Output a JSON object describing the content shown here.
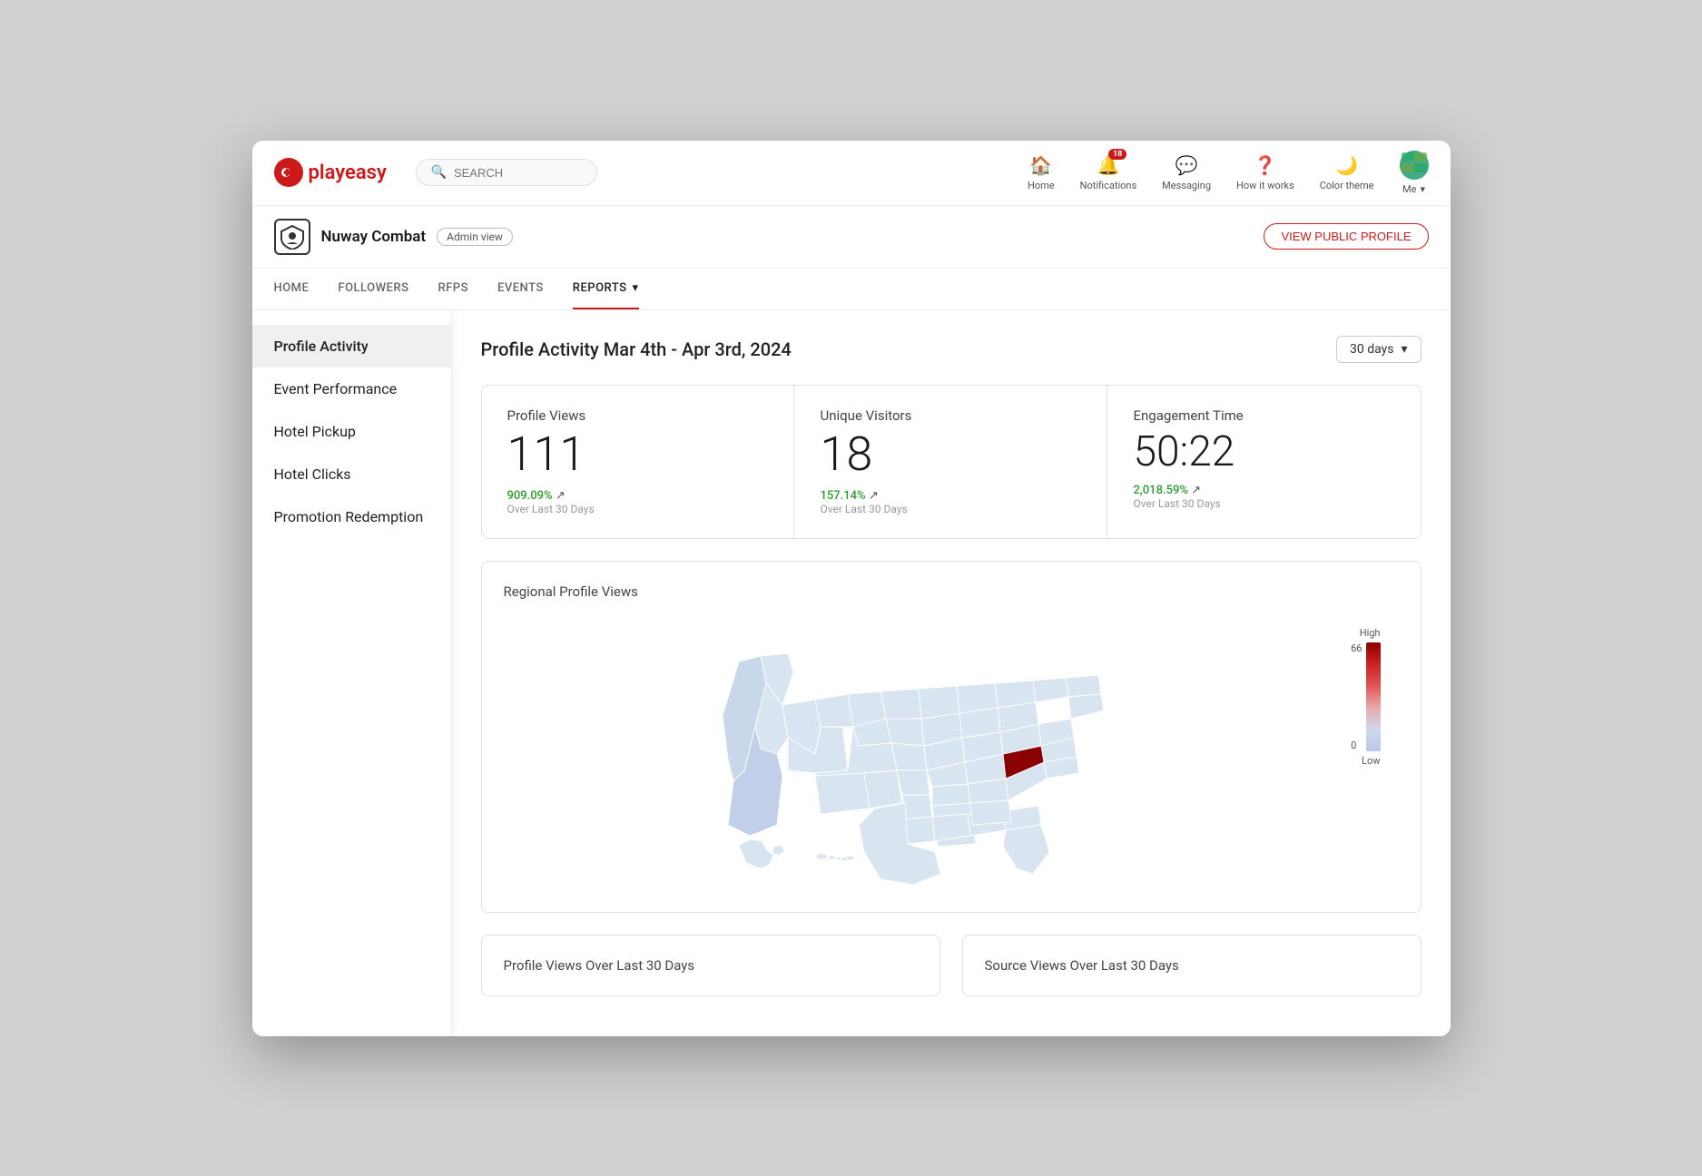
{
  "app": {
    "logo_letter": "p",
    "logo_text_prefix": "play",
    "logo_text_suffix": "easy"
  },
  "search": {
    "placeholder": "SEARCH"
  },
  "nav": {
    "home_label": "Home",
    "notifications_label": "Notifications",
    "notification_count": "18",
    "messaging_label": "Messaging",
    "how_it_works_label": "How it works",
    "color_theme_label": "Color theme",
    "me_label": "Me"
  },
  "profile": {
    "name": "Nuway Combat",
    "badge": "Admin view",
    "view_public_btn": "VIEW PUBLIC PROFILE"
  },
  "sub_nav": {
    "items": [
      {
        "label": "HOME",
        "active": false
      },
      {
        "label": "FOLLOWERS",
        "active": false
      },
      {
        "label": "RFPS",
        "active": false
      },
      {
        "label": "EVENTS",
        "active": false
      },
      {
        "label": "REPORTS",
        "active": true
      }
    ]
  },
  "sidebar": {
    "items": [
      {
        "label": "Profile Activity",
        "active": true
      },
      {
        "label": "Event Performance",
        "active": false
      },
      {
        "label": "Hotel Pickup",
        "active": false
      },
      {
        "label": "Hotel Clicks",
        "active": false
      },
      {
        "label": "Promotion Redemption",
        "active": false
      }
    ]
  },
  "content": {
    "title": "Profile Activity Mar 4th - Apr 3rd, 2024",
    "days_dropdown": "30 days",
    "stats": [
      {
        "label": "Profile Views",
        "value": "111",
        "percent": "909.09%",
        "arrow": "↗",
        "sublabel": "Over Last 30 Days"
      },
      {
        "label": "Unique Visitors",
        "value": "18",
        "percent": "157.14%",
        "arrow": "↗",
        "sublabel": "Over Last 30 Days"
      },
      {
        "label": "Engagement Time",
        "value": "50:22",
        "percent": "2,018.59%",
        "arrow": "↗",
        "sublabel": "Over Last 30 Days"
      }
    ],
    "map_title": "Regional Profile Views",
    "legend_high": "High",
    "legend_high_val": "66",
    "legend_low_val": "0",
    "legend_low": "Low",
    "bottom_left_title": "Profile Views Over Last 30 Days",
    "bottom_right_title": "Source Views Over Last 30 Days"
  }
}
